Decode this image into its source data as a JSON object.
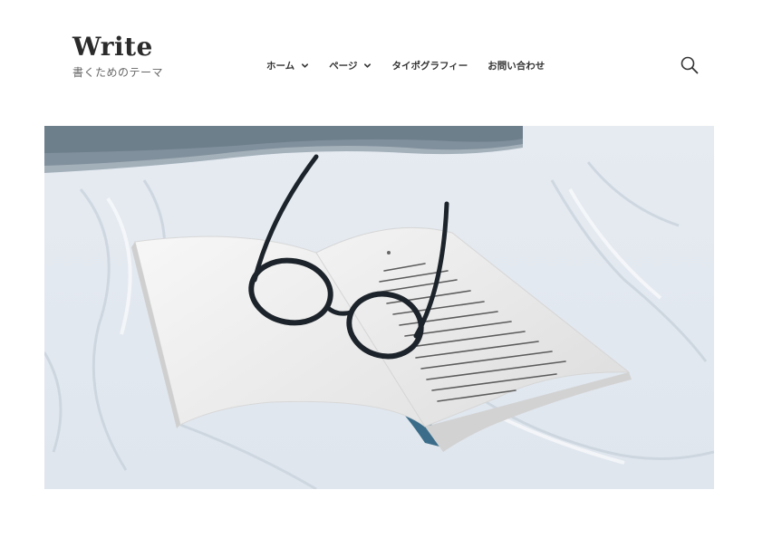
{
  "site": {
    "title": "Write",
    "description": "書くためのテーマ"
  },
  "nav": {
    "items": [
      {
        "label": "ホーム",
        "has_dropdown": true
      },
      {
        "label": "ページ",
        "has_dropdown": true
      },
      {
        "label": "タイポグラフィー",
        "has_dropdown": false
      },
      {
        "label": "お問い合わせ",
        "has_dropdown": false
      }
    ]
  },
  "icons": {
    "search": "search-icon",
    "dropdown": "chevron-down-icon"
  },
  "hero": {
    "subject": "open book with eyeglasses on white bed sheets"
  },
  "colors": {
    "title": "#2b2b2b",
    "text": "#333333",
    "muted": "#666666",
    "background": "#ffffff"
  }
}
